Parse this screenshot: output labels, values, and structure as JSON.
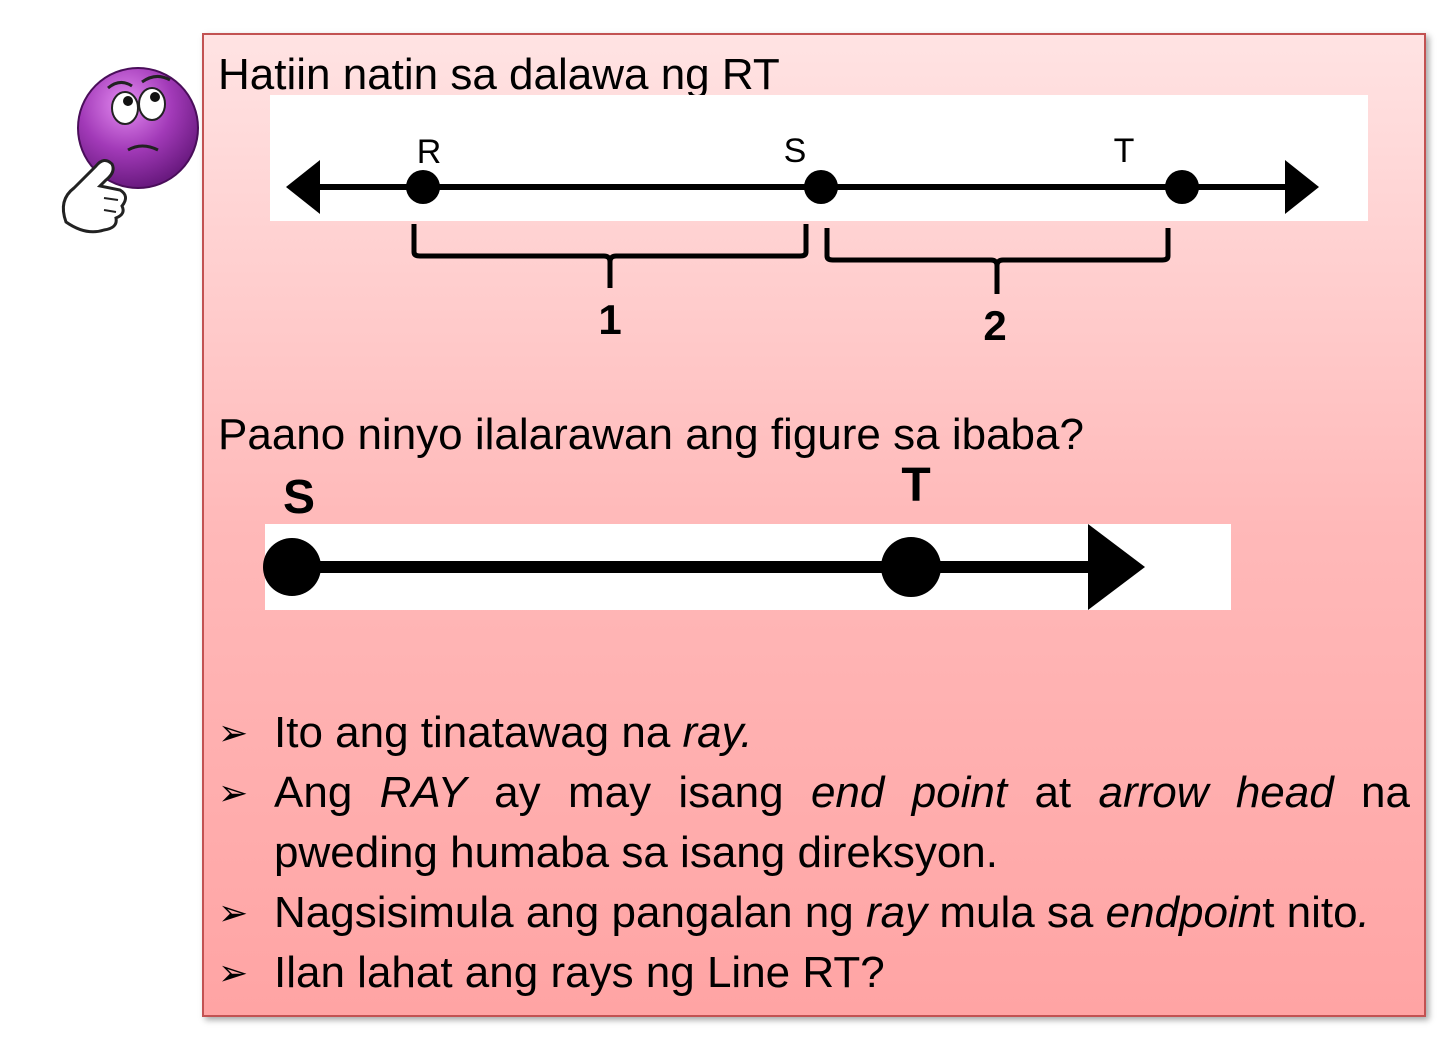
{
  "heading1": "Hatiin natin sa dalawa ng RT",
  "heading2": "Paano ninyo ilalarawan ang figure sa ibaba?",
  "line_figure": {
    "points": [
      "R",
      "S",
      "T"
    ],
    "brace_labels": [
      "1",
      "2"
    ]
  },
  "ray_figure": {
    "points": [
      "S",
      "T"
    ]
  },
  "bullets": {
    "b1": {
      "text": "Ito ang tinatawag na ",
      "em": "ray."
    },
    "b2": {
      "t1": "Ang ",
      "em1": "RAY",
      "t2": " ay may isang ",
      "em2": "end point",
      "t3": " at ",
      "em3": "arrow head",
      "t4": " na pweding humaba sa isang direksyon."
    },
    "b3": {
      "t1": "Nagsisimula ang pangalan ng ",
      "em1": "ray",
      "t2": " mula sa ",
      "em2": "endpoin",
      "t3": "t nito",
      "em3": "."
    },
    "b4": {
      "text": "Ilan lahat ang rays ng Line RT?"
    }
  },
  "bullet_marker": "➢",
  "icons": {
    "mascot": "thinking-face-icon"
  },
  "colors": {
    "card_top": "#ffe3e3",
    "card_bottom": "#ffa4a4",
    "card_border": "#c25252",
    "mascot": "#8e1fa6"
  }
}
